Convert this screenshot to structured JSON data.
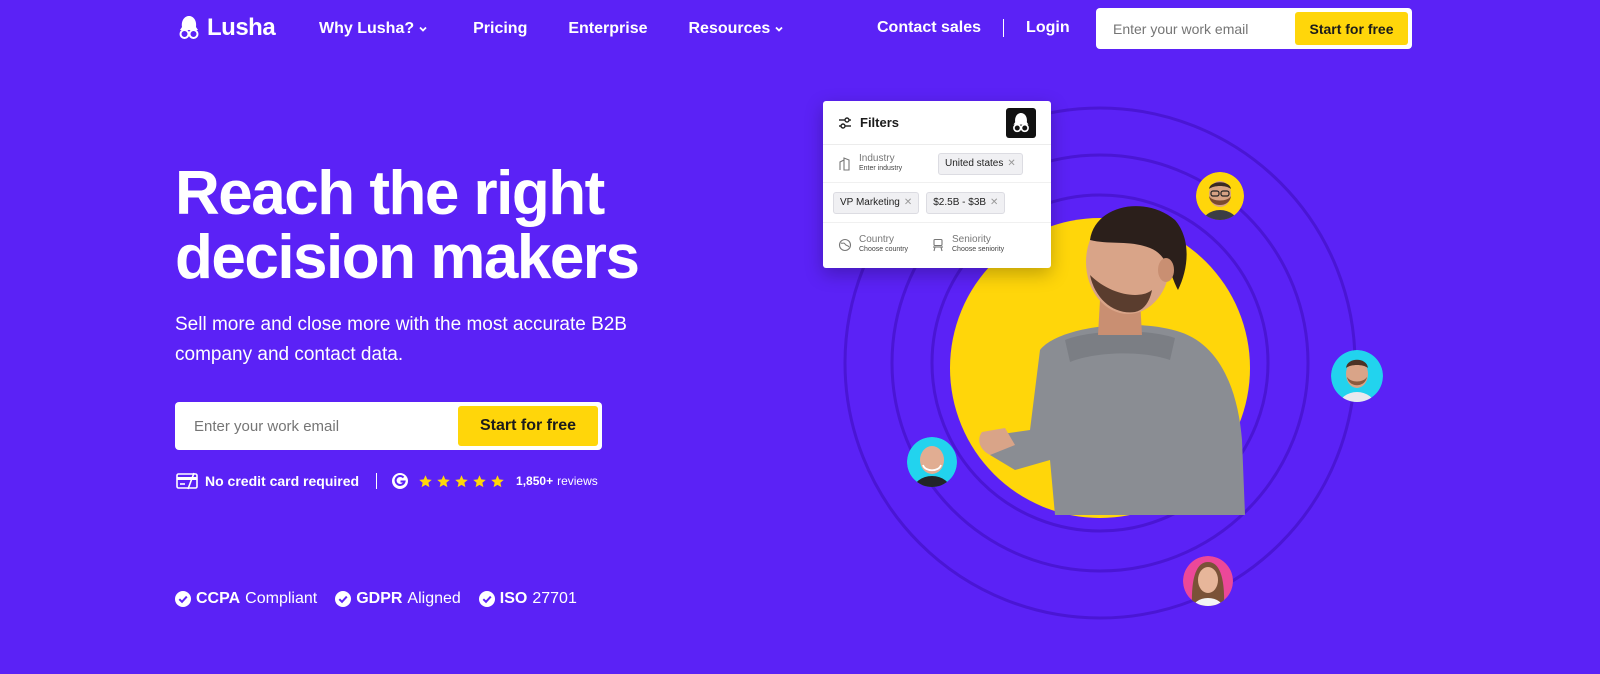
{
  "brand": {
    "name": "Lusha",
    "accent": "#5b22f6",
    "cta": "#ffd60a"
  },
  "nav": {
    "links": [
      {
        "label": "Why Lusha?",
        "has_dropdown": true
      },
      {
        "label": "Pricing",
        "has_dropdown": false
      },
      {
        "label": "Enterprise",
        "has_dropdown": false
      },
      {
        "label": "Resources",
        "has_dropdown": true
      }
    ],
    "contact_sales": "Contact sales",
    "login": "Login",
    "email_placeholder": "Enter your work email",
    "cta": "Start for free"
  },
  "hero": {
    "title_line1": "Reach the right",
    "title_line2": "decision makers",
    "subtitle_line1": "Sell more and close more with the most accurate B2B",
    "subtitle_line2": "company and contact data.",
    "email_placeholder": "Enter your work email",
    "cta": "Start for free",
    "no_cc": "No credit card required",
    "rating_stars": 5,
    "reviews_count": "1,850+",
    "reviews_label": "reviews"
  },
  "compliance": [
    {
      "bold": "CCPA",
      "text": "Compliant"
    },
    {
      "bold": "GDPR",
      "text": "Aligned"
    },
    {
      "bold": "ISO",
      "text": "27701"
    }
  ],
  "filters_card": {
    "title": "Filters",
    "industry_label": "Industry",
    "industry_hint": "Enter industry",
    "chip_location": "United states",
    "chip_role": "VP Marketing",
    "chip_revenue": "$2.5B - $3B",
    "country_label": "Country",
    "country_hint": "Choose country",
    "seniority_label": "Seniority",
    "seniority_hint": "Choose seniority"
  }
}
